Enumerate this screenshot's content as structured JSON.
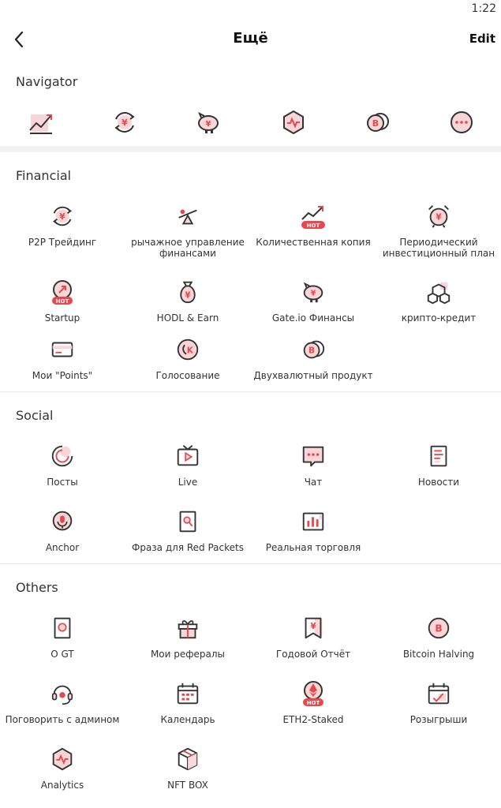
{
  "status_bar": {
    "time": "1:22"
  },
  "header": {
    "title": "Ещё",
    "edit_label": "Edit"
  },
  "navigator": {
    "title": "Navigator"
  },
  "financial": {
    "title": "Financial",
    "items": [
      {
        "label": "P2P Трейдинг"
      },
      {
        "label": "рычажное управление\nфинансами"
      },
      {
        "label": "Количественная копия",
        "badge": "HOT"
      },
      {
        "label": "Периодический\nинвестиционный план"
      },
      {
        "label": "Startup",
        "badge": "HOT"
      },
      {
        "label": "HODL & Earn"
      },
      {
        "label": "Gate.io Финансы"
      },
      {
        "label": "крипто-кредит"
      },
      {
        "label": "Мои \"Points\""
      },
      {
        "label": "Голосование"
      },
      {
        "label": "Двухвалютный продукт"
      }
    ]
  },
  "social": {
    "title": "Social",
    "items": [
      {
        "label": "Посты"
      },
      {
        "label": "Live"
      },
      {
        "label": "Чат"
      },
      {
        "label": "Новости"
      },
      {
        "label": "Anchor"
      },
      {
        "label": "Фраза для Red Packets"
      },
      {
        "label": "Реальная торговля"
      }
    ]
  },
  "others": {
    "title": "Others",
    "items": [
      {
        "label": "О GT"
      },
      {
        "label": "Мои рефералы"
      },
      {
        "label": "Годовой Отчёт"
      },
      {
        "label": "Bitcoin Halving"
      },
      {
        "label": "Поговорить с админом"
      },
      {
        "label": "Календарь"
      },
      {
        "label": "ETH2-Staked",
        "badge": "HOT"
      },
      {
        "label": "Розыгрыши"
      },
      {
        "label": "Analytics"
      },
      {
        "label": "NFT BOX"
      }
    ]
  },
  "colors": {
    "accent": "#e5484d",
    "accent_light": "#f8d5d6",
    "stroke": "#333333"
  }
}
